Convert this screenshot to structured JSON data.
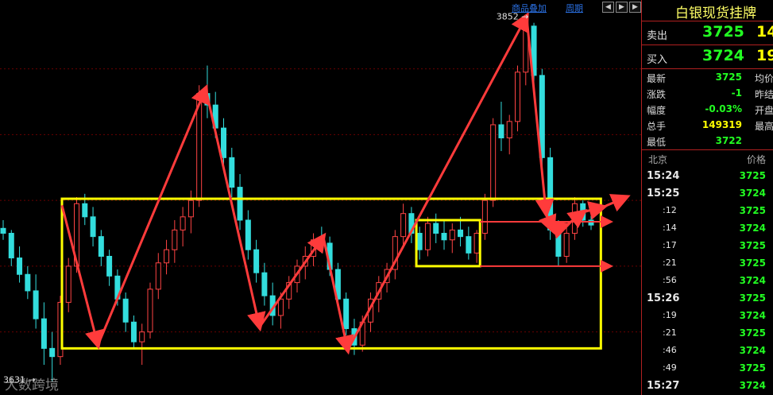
{
  "chart_data": {
    "type": "candlestick",
    "title": "",
    "xlabel": "",
    "ylabel": "",
    "ylim": [
      3626,
      3858
    ],
    "price_labels": {
      "high": "3852",
      "low": "3631"
    },
    "colors": {
      "up": "#ff4444",
      "down": "#33dddd",
      "grid": "#6a0000",
      "box": "#ffff00",
      "arrow": "#ff3b3b"
    },
    "candles": [
      [
        3723,
        3728,
        3716,
        3720
      ],
      [
        3720,
        3722,
        3700,
        3705
      ],
      [
        3705,
        3712,
        3690,
        3695
      ],
      [
        3695,
        3700,
        3680,
        3685
      ],
      [
        3685,
        3695,
        3662,
        3668
      ],
      [
        3668,
        3678,
        3640,
        3650
      ],
      [
        3650,
        3660,
        3630,
        3645
      ],
      [
        3645,
        3682,
        3640,
        3678
      ],
      [
        3678,
        3705,
        3672,
        3700
      ],
      [
        3700,
        3742,
        3696,
        3738
      ],
      [
        3738,
        3744,
        3725,
        3730
      ],
      [
        3730,
        3736,
        3712,
        3718
      ],
      [
        3718,
        3722,
        3700,
        3706
      ],
      [
        3706,
        3710,
        3688,
        3694
      ],
      [
        3694,
        3698,
        3676,
        3680
      ],
      [
        3680,
        3684,
        3660,
        3666
      ],
      [
        3666,
        3670,
        3650,
        3654
      ],
      [
        3654,
        3665,
        3640,
        3660
      ],
      [
        3660,
        3690,
        3656,
        3686
      ],
      [
        3686,
        3708,
        3680,
        3702
      ],
      [
        3702,
        3716,
        3695,
        3710
      ],
      [
        3710,
        3728,
        3702,
        3722
      ],
      [
        3722,
        3736,
        3712,
        3730
      ],
      [
        3730,
        3746,
        3720,
        3740
      ],
      [
        3740,
        3810,
        3736,
        3805
      ],
      [
        3805,
        3822,
        3790,
        3798
      ],
      [
        3798,
        3806,
        3778,
        3784
      ],
      [
        3784,
        3790,
        3760,
        3766
      ],
      [
        3766,
        3772,
        3742,
        3748
      ],
      [
        3748,
        3756,
        3722,
        3728
      ],
      [
        3728,
        3734,
        3704,
        3710
      ],
      [
        3710,
        3716,
        3690,
        3696
      ],
      [
        3696,
        3702,
        3676,
        3682
      ],
      [
        3682,
        3690,
        3664,
        3670
      ],
      [
        3670,
        3684,
        3662,
        3680
      ],
      [
        3680,
        3694,
        3674,
        3690
      ],
      [
        3690,
        3704,
        3684,
        3700
      ],
      [
        3700,
        3712,
        3692,
        3706
      ],
      [
        3706,
        3720,
        3700,
        3716
      ],
      [
        3716,
        3724,
        3708,
        3714
      ],
      [
        3714,
        3718,
        3694,
        3698
      ],
      [
        3698,
        3702,
        3676,
        3680
      ],
      [
        3680,
        3684,
        3658,
        3662
      ],
      [
        3662,
        3668,
        3646,
        3652
      ],
      [
        3652,
        3670,
        3648,
        3666
      ],
      [
        3666,
        3684,
        3660,
        3680
      ],
      [
        3680,
        3694,
        3672,
        3690
      ],
      [
        3690,
        3702,
        3684,
        3698
      ],
      [
        3698,
        3722,
        3692,
        3718
      ],
      [
        3718,
        3738,
        3712,
        3732
      ],
      [
        3732,
        3736,
        3714,
        3720
      ],
      [
        3720,
        3724,
        3704,
        3710
      ],
      [
        3710,
        3730,
        3706,
        3726
      ],
      [
        3726,
        3732,
        3714,
        3720
      ],
      [
        3720,
        3728,
        3710,
        3716
      ],
      [
        3716,
        3726,
        3708,
        3722
      ],
      [
        3722,
        3730,
        3712,
        3718
      ],
      [
        3718,
        3724,
        3704,
        3708
      ],
      [
        3708,
        3722,
        3702,
        3720
      ],
      [
        3720,
        3744,
        3716,
        3740
      ],
      [
        3740,
        3790,
        3736,
        3786
      ],
      [
        3786,
        3800,
        3770,
        3778
      ],
      [
        3778,
        3792,
        3768,
        3788
      ],
      [
        3788,
        3822,
        3782,
        3818
      ],
      [
        3818,
        3852,
        3810,
        3846
      ],
      [
        3846,
        3848,
        3810,
        3816
      ],
      [
        3816,
        3820,
        3760,
        3766
      ],
      [
        3766,
        3772,
        3716,
        3722
      ],
      [
        3722,
        3728,
        3700,
        3706
      ],
      [
        3706,
        3724,
        3702,
        3720
      ],
      [
        3720,
        3742,
        3716,
        3738
      ],
      [
        3738,
        3740,
        3724,
        3728
      ],
      [
        3728,
        3732,
        3722,
        3725
      ]
    ]
  },
  "header": {
    "overlay_link": "商品叠加",
    "period_link": "周期"
  },
  "panel": {
    "title": "白银现货挂牌",
    "sell": {
      "label": "卖出",
      "price": "3725",
      "volume": "14"
    },
    "buy": {
      "label": "买入",
      "price": "3724",
      "volume": "19"
    },
    "stats": [
      {
        "label": "最新",
        "value": "3725",
        "right": "均价",
        "color": "#22ff22"
      },
      {
        "label": "涨跌",
        "value": "-1",
        "right": "昨结",
        "color": "#22ff22"
      },
      {
        "label": "幅度",
        "value": "-0.03%",
        "right": "开盘",
        "color": "#22ff22"
      },
      {
        "label": "总手",
        "value": "149319",
        "right": "最高",
        "color": "#ffff00"
      },
      {
        "label": "最低",
        "value": "3722",
        "right": "",
        "color": "#22ff22"
      }
    ],
    "tick_header": {
      "left": "北京",
      "right": "价格"
    },
    "ticks": [
      {
        "time": "15:24",
        "price": "3725"
      },
      {
        "time": "15:25",
        "price": "3724"
      },
      {
        "time": ":12",
        "price": "3725"
      },
      {
        "time": ":14",
        "price": "3724"
      },
      {
        "time": ":17",
        "price": "3725"
      },
      {
        "time": ":21",
        "price": "3725"
      },
      {
        "time": ":56",
        "price": "3724"
      },
      {
        "time": "15:26",
        "price": "3725"
      },
      {
        "time": ":19",
        "price": "3724"
      },
      {
        "time": ":21",
        "price": "3725"
      },
      {
        "time": ":46",
        "price": "3724"
      },
      {
        "time": ":49",
        "price": "3725"
      },
      {
        "time": "15:27",
        "price": "3724"
      }
    ]
  },
  "watermark": "大数跨境"
}
